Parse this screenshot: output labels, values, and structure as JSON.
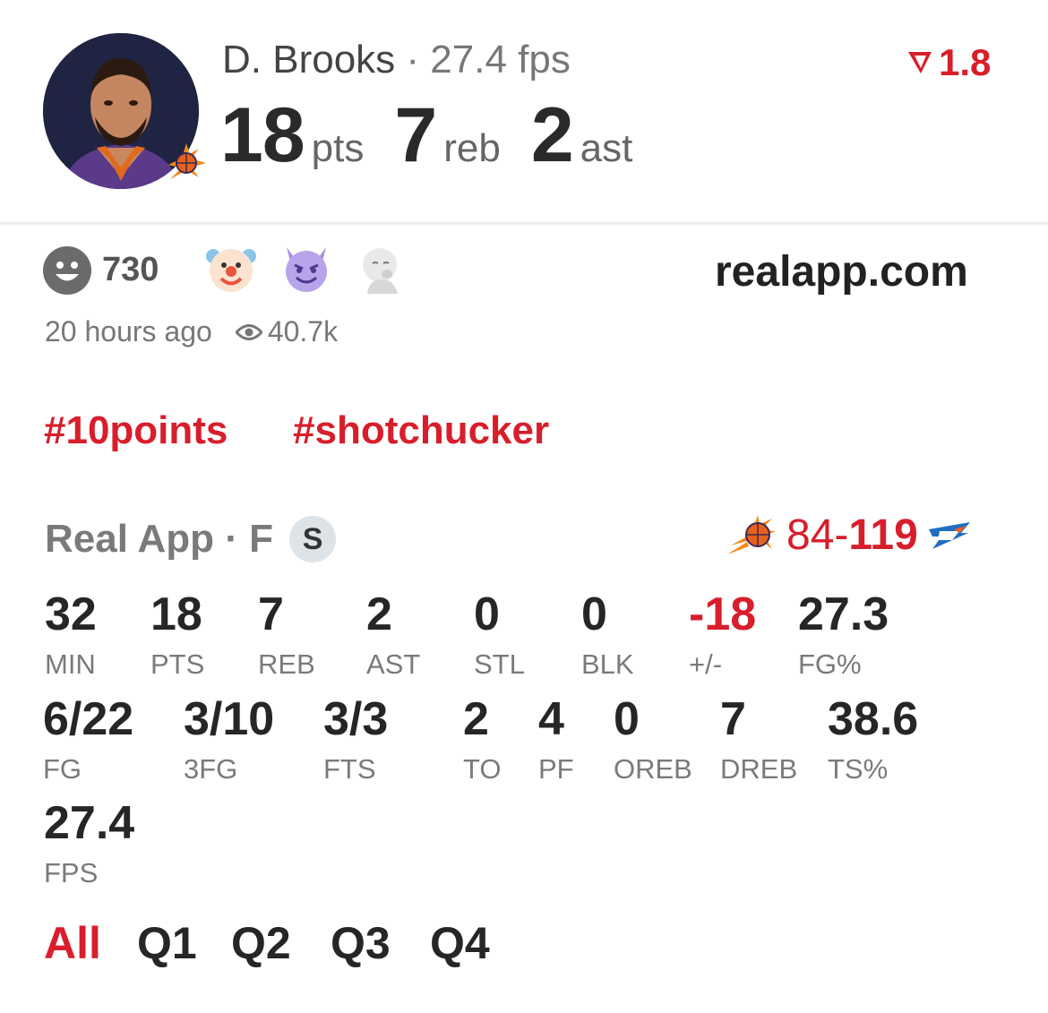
{
  "player": {
    "name": "D. Brooks",
    "separator": "·",
    "fps_text": "27.4 fps",
    "pts": "18",
    "pts_unit": "pts",
    "reb": "7",
    "reb_unit": "reb",
    "ast": "2",
    "ast_unit": "ast",
    "rating": "1.8"
  },
  "reactions": {
    "count": "730",
    "emojis": [
      "clown-face",
      "smiling-devil",
      "smirking-baby"
    ]
  },
  "site": "realapp.com",
  "meta": {
    "time": "20 hours ago",
    "views": "40.7k"
  },
  "tags": [
    "#10points",
    "#shotchucker"
  ],
  "game": {
    "label": "Real App · F",
    "badge": "S",
    "score_home": "84",
    "score_dash": "-",
    "score_away": "119"
  },
  "stats_row1": [
    {
      "value": "32",
      "label": "MIN"
    },
    {
      "value": "18",
      "label": "PTS"
    },
    {
      "value": "7",
      "label": "REB"
    },
    {
      "value": "2",
      "label": "AST"
    },
    {
      "value": "0",
      "label": "STL"
    },
    {
      "value": "0",
      "label": "BLK"
    },
    {
      "value": "-18",
      "label": "+/-"
    },
    {
      "value": "27.3",
      "label": "FG%"
    }
  ],
  "stats_row2": [
    {
      "value": "6/22",
      "label": "FG"
    },
    {
      "value": "3/10",
      "label": "3FG"
    },
    {
      "value": "3/3",
      "label": "FTS"
    },
    {
      "value": "2",
      "label": "TO"
    },
    {
      "value": "4",
      "label": "PF"
    },
    {
      "value": "0",
      "label": "OREB"
    },
    {
      "value": "7",
      "label": "DREB"
    },
    {
      "value": "38.6",
      "label": "TS%"
    }
  ],
  "stats_row3": [
    {
      "value": "27.4",
      "label": "FPS"
    }
  ],
  "periods": [
    "All",
    "Q1",
    "Q2",
    "Q3",
    "Q4"
  ],
  "colors": {
    "accent": "#d81e2b",
    "text": "#262626",
    "muted": "#7a7a7a"
  }
}
